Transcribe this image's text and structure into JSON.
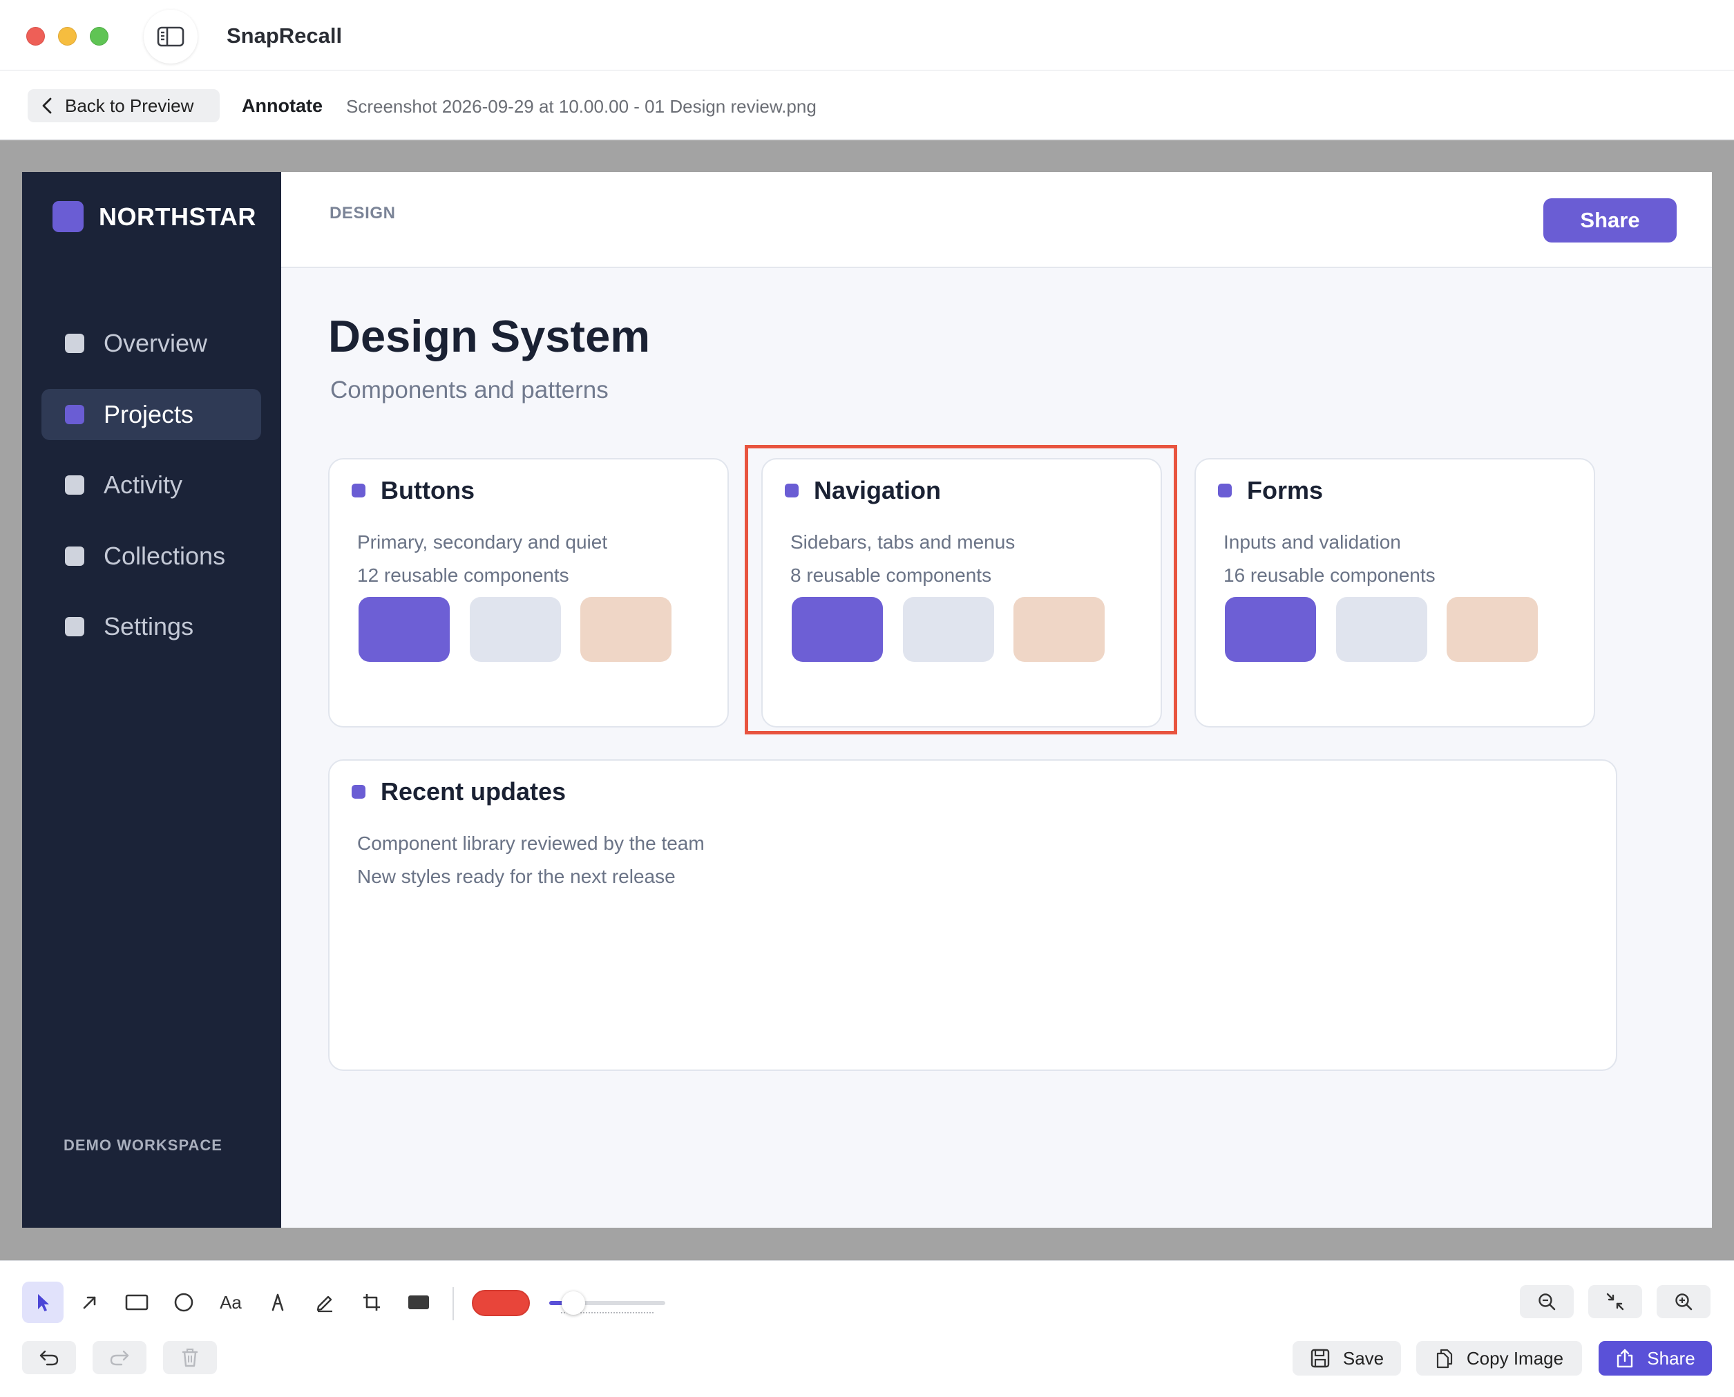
{
  "window": {
    "app_title": "SnapRecall"
  },
  "subbar": {
    "back_label": "Back to Preview",
    "mode_label": "Annotate",
    "file_name": "Screenshot 2026-09-29 at 10.00.00 - 01 Design review.png"
  },
  "screenshot": {
    "brand": "NORTHSTAR",
    "nav": [
      {
        "label": "Overview",
        "active": false
      },
      {
        "label": "Projects",
        "active": true
      },
      {
        "label": "Activity",
        "active": false
      },
      {
        "label": "Collections",
        "active": false
      },
      {
        "label": "Settings",
        "active": false
      }
    ],
    "footer": "DEMO WORKSPACE",
    "breadcrumb": "DESIGN",
    "share_label": "Share",
    "title": "Design System",
    "subtitle": "Components and patterns",
    "cards": [
      {
        "title": "Buttons",
        "line1": "Primary, secondary and quiet",
        "line2": "12 reusable components"
      },
      {
        "title": "Navigation",
        "line1": "Sidebars, tabs and menus",
        "line2": "8 reusable components"
      },
      {
        "title": "Forms",
        "line1": "Inputs and validation",
        "line2": "16 reusable components"
      }
    ],
    "updates": {
      "title": "Recent updates",
      "line1": "Component library reviewed by the team",
      "line2": "New styles ready for the next release"
    },
    "colors": {
      "accent": "#6a5dd4",
      "sidebar": "#1b2338",
      "swatch_neutral": "#e0e4ee",
      "swatch_peach": "#efd6c6"
    }
  },
  "annotation": {
    "type": "rectangle",
    "color": "#e8543f",
    "target": "Navigation card"
  },
  "toolbar": {
    "tools": [
      "select-tool",
      "arrow-tool",
      "rectangle-tool",
      "ellipse-tool",
      "text-tool",
      "highlighter-tool",
      "pen-tool",
      "crop-tool",
      "redact-tool"
    ],
    "active_tool": "select-tool",
    "text_tool_label": "Aa",
    "stroke_color": "#e8453a",
    "stroke_width_level": 0.2,
    "zoom_buttons": [
      "zoom-out-icon",
      "fit-to-window-icon",
      "zoom-in-icon"
    ],
    "save_label": "Save",
    "copy_label": "Copy Image",
    "share_label": "Share",
    "accent": "#5a51d8"
  }
}
